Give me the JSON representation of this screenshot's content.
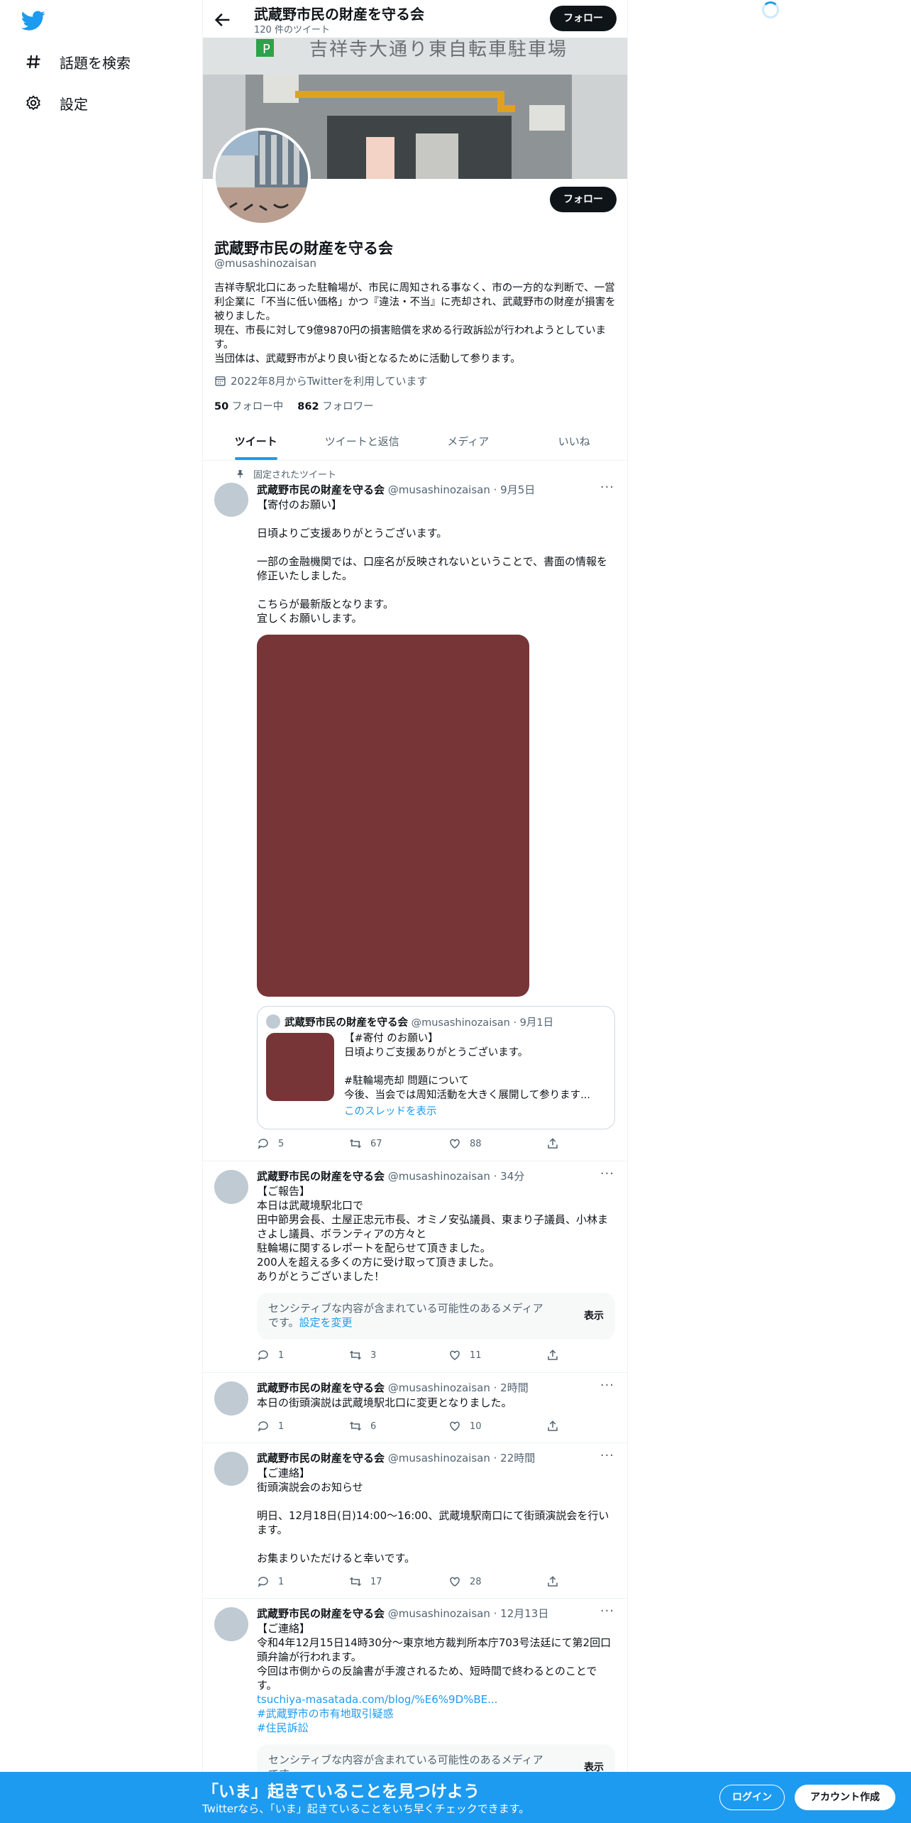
{
  "nav": {
    "explore_label": "話題を検索",
    "settings_label": "設定"
  },
  "header": {
    "title": "武蔵野市民の財産を守る会",
    "tweet_count": "120 件のツイート",
    "follow_label": "フォロー"
  },
  "banner": {
    "sign_text": "吉祥寺大通り東自転車駐車場"
  },
  "profile": {
    "name": "武蔵野市民の財産を守る会",
    "handle": "@musashinozaisan",
    "bio": "吉祥寺駅北口にあった駐輪場が、市民に周知される事なく、市の一方的な判断で、一営利企業に「不当に低い価格」かつ『違法・不当』に売却され、武蔵野市の財産が損害を被りました。\n現在、市長に対して9億9870円の損害賠償を求める行政訴訟が行われようとしています。\n当団体は、武蔵野市がより良い街となるために活動して参ります。",
    "joined": "2022年8月からTwitterを利用しています",
    "following_count": "50",
    "following_label": "フォロー中",
    "followers_count": "862",
    "followers_label": "フォロワー",
    "follow_label": "フォロー"
  },
  "tabs": [
    "ツイート",
    "ツイートと返信",
    "メディア",
    "いいね"
  ],
  "tweets": [
    {
      "pinned_label": "固定されたツイート",
      "name": "武蔵野市民の財産を守る会",
      "meta": "@musashinozaisan · 9月5日",
      "text": "【寄付のお願い】\n\n日頃よりご支援ありがとうございます。\n\n一部の金融機関では、口座名が反映されないということで、書面の情報を修正いたしました。\n\nこちらが最新版となります。\n宜しくお願いします。",
      "media_color": "#773538",
      "quote": {
        "name": "武蔵野市民の財産を守る会",
        "meta": "@musashinozaisan · 9月1日",
        "text": "【#寄付 のお願い】\n日頃よりご支援ありがとうございます。\n\n#駐輪場売却 問題について\n今後、当会では周知活動を大きく展開して参ります...",
        "thread_link": "このスレッドを表示"
      },
      "replies": "5",
      "retweets": "67",
      "likes": "88"
    },
    {
      "name": "武蔵野市民の財産を守る会",
      "meta": "@musashinozaisan · 34分",
      "text": "【ご報告】\n本日は武蔵境駅北口で\n田中節男会長、土屋正忠元市長、オミノ安弘議員、東まり子議員、小林まさよし議員、ボランティアの方々と\n駐輪場に関するレポートを配らせて頂きました。\n200人を超える多くの方に受け取って頂きました。\nありがとうございました！",
      "sensitive_text": "センシティブな内容が含まれている可能性のあるメディアです。",
      "sensitive_link": "設定を変更",
      "sensitive_show": "表示",
      "replies": "1",
      "retweets": "3",
      "likes": "11"
    },
    {
      "name": "武蔵野市民の財産を守る会",
      "meta": "@musashinozaisan · 2時間",
      "text": "本日の街頭演説は武蔵境駅北口に変更となりました。",
      "replies": "1",
      "retweets": "6",
      "likes": "10"
    },
    {
      "name": "武蔵野市民の財産を守る会",
      "meta": "@musashinozaisan · 22時間",
      "text": "【ご連絡】\n街頭演説会のお知らせ\n\n明日、12月18日(日)14:00～16:00、武蔵境駅南口にて街頭演説会を行います。\n\nお集まりいただけると幸いです。",
      "replies": "1",
      "retweets": "17",
      "likes": "28"
    },
    {
      "name": "武蔵野市民の財産を守る会",
      "meta": "@musashinozaisan · 12月13日",
      "text": "【ご連絡】\n令和4年12月15日14時30分～東京地方裁判所本庁703号法廷にて第2回口頭弁論が行われます。\n今回は市側からの反論書が手渡されるため、短時間で終わるとのことです。",
      "links": [
        "tsuchiya-masatada.com/blog/%E6%9D%BE...",
        "#武蔵野市の市有地取引疑惑",
        "#住民訴訟"
      ],
      "sensitive_text": "センシティブな内容が含まれている可能性のあるメディアです。",
      "sensitive_show": "表示"
    }
  ],
  "bottom_bar": {
    "headline": "「いま」起きていることを見つけよう",
    "sub": "Twitterなら、「いま」起きていることをいち早くチェックできます。",
    "login": "ログイン",
    "signup": "アカウント作成"
  },
  "colors": {
    "accent": "#1d9bf0",
    "text": "#0f1419",
    "muted": "#536471"
  }
}
